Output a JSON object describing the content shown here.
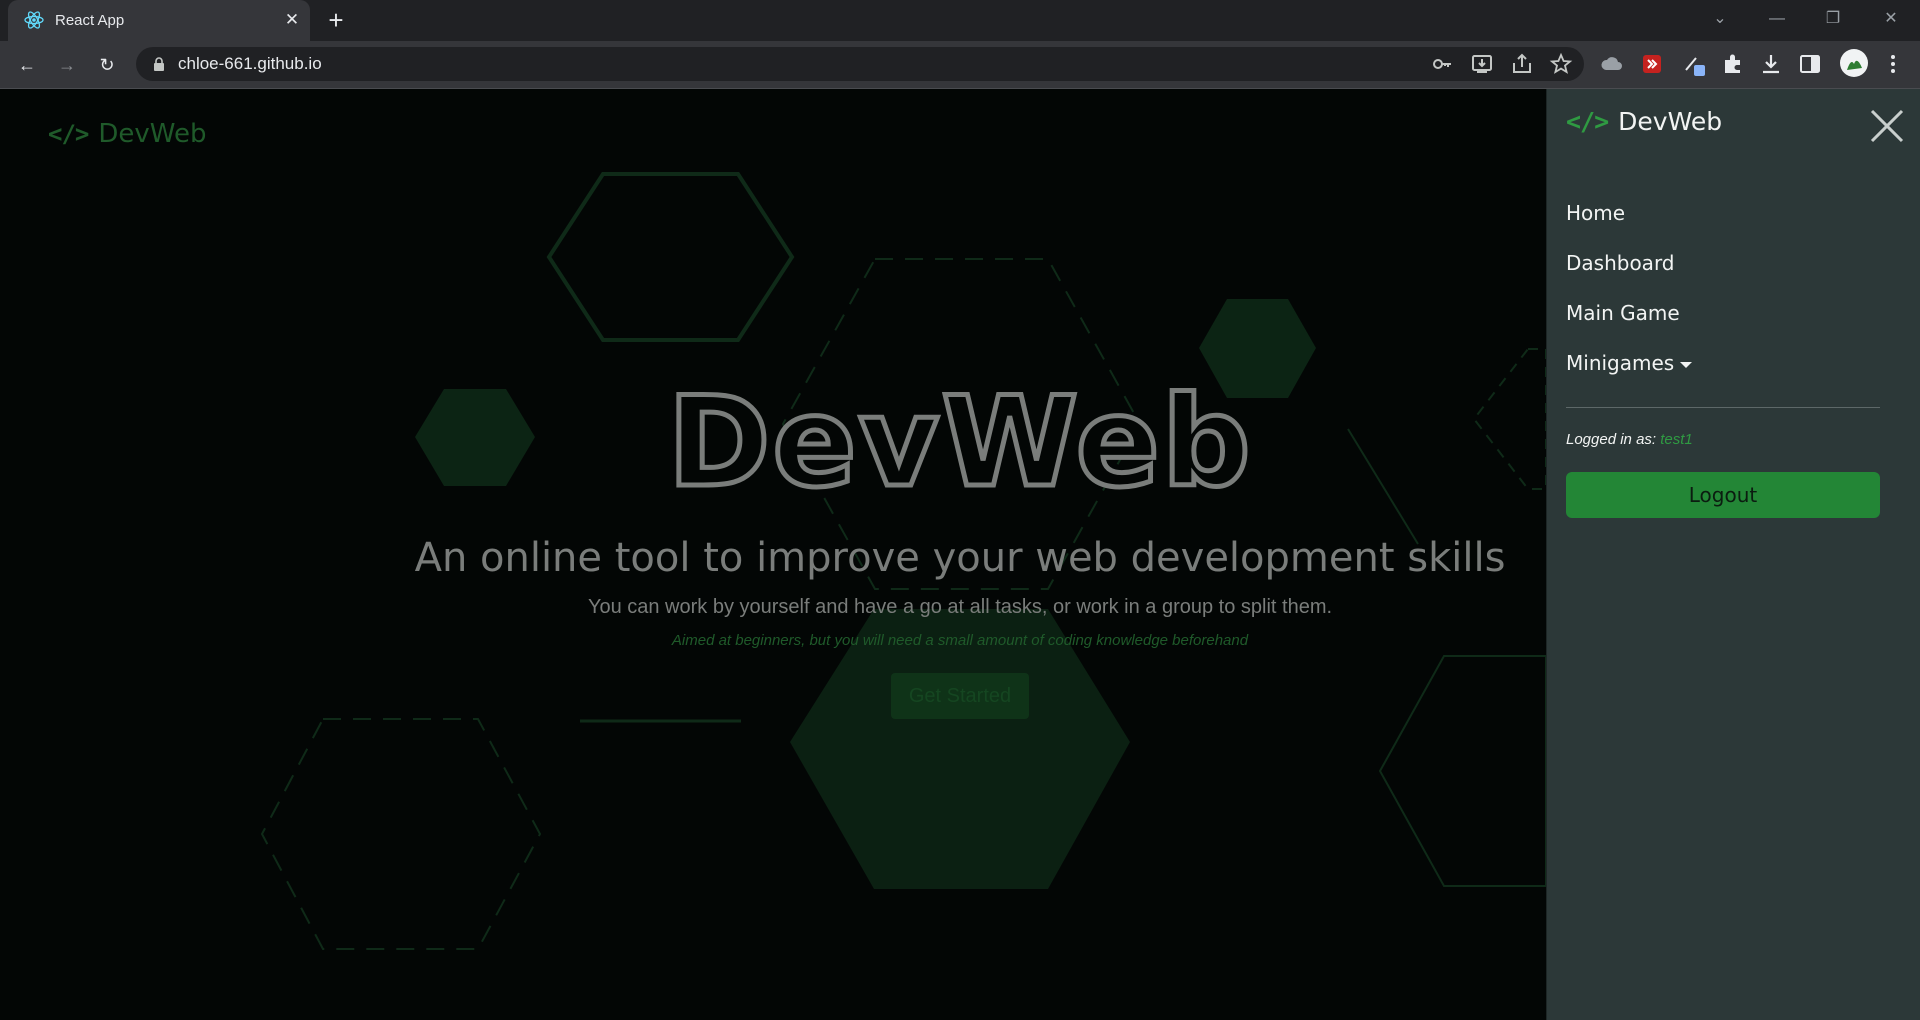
{
  "browser": {
    "tab_title": "React App",
    "tab_close": "✕",
    "new_tab": "+",
    "url": "chloe-661.github.io",
    "window_controls": {
      "dropdown": "⌄",
      "minimize": "—",
      "restore": "❐",
      "close": "✕"
    },
    "nav": {
      "back": "←",
      "forward": "→",
      "reload": "↻"
    },
    "omnibox_icons": [
      "key-icon",
      "install-icon",
      "share-icon",
      "bookmark-star-icon"
    ],
    "extension_icons": [
      "cloud-extension-icon",
      "red-extension-icon",
      "pen-extension-icon",
      "puzzle-icon",
      "download-icon",
      "side-panel-icon",
      "profile-avatar",
      "kebab-menu-icon"
    ]
  },
  "page": {
    "brand": "DevWeb",
    "code_icon": "</>",
    "hero_title": "DevWeb",
    "subtitle": "An online tool to improve your web development skills",
    "description": "You can work by yourself and have a go at all tasks, or work in a group to split them.",
    "note": "Aimed at beginners, but you will need a small amount of coding knowledge beforehand",
    "cta_label": "Get Started"
  },
  "side_menu": {
    "brand": "DevWeb",
    "code_icon": "</>",
    "items": [
      {
        "label": "Home"
      },
      {
        "label": "Dashboard"
      },
      {
        "label": "Main Game"
      },
      {
        "label": "Minigames"
      }
    ],
    "logged_in_label": "Logged in as:",
    "username": "test1",
    "logout_label": "Logout"
  },
  "colors": {
    "accent_green": "#238636",
    "menu_bg": "#2c3838",
    "page_bg": "#030605",
    "hex_fill": "#0c2414"
  }
}
